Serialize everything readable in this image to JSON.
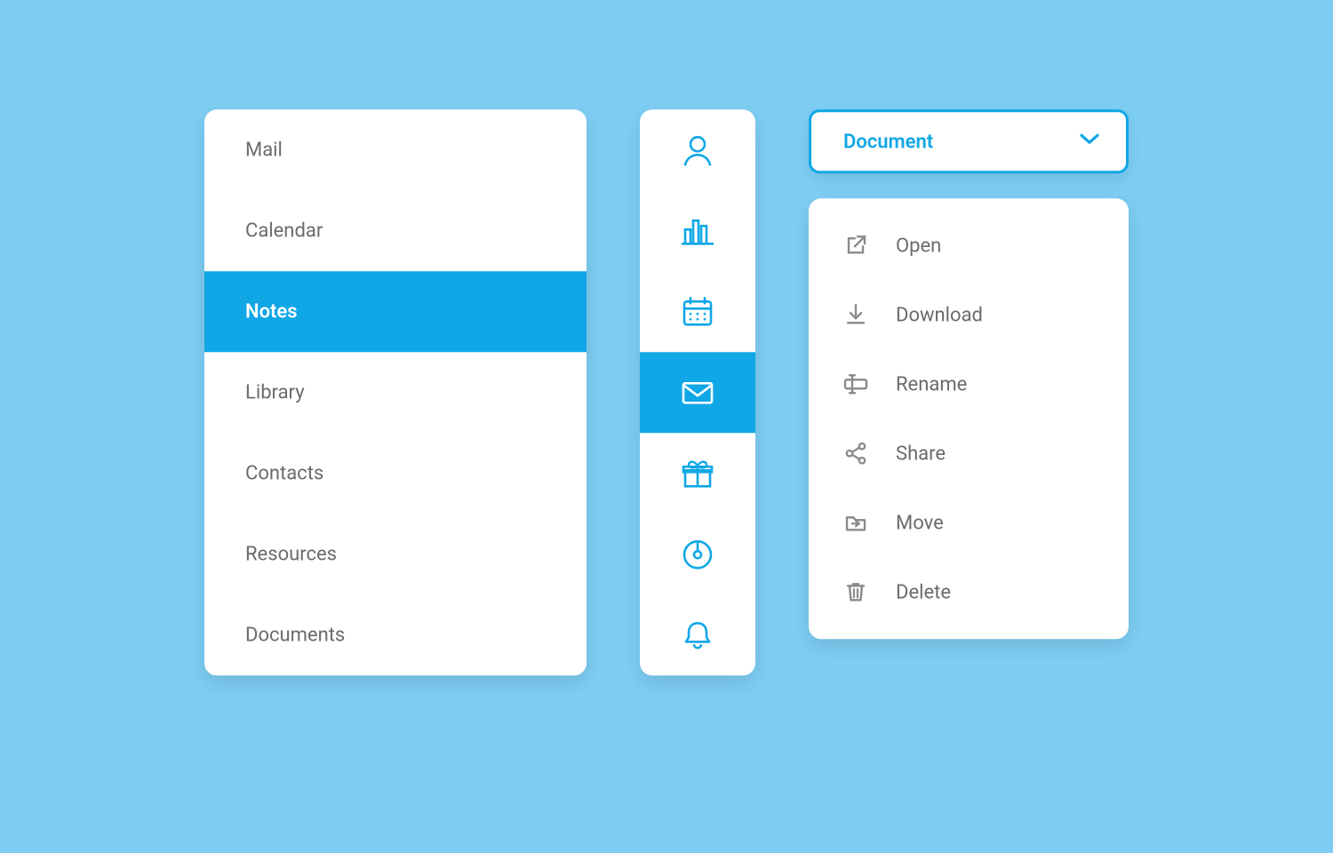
{
  "colors": {
    "accent": "#0fa7e6",
    "bg": "#7ecef4",
    "text": "#6b6b6b"
  },
  "menu": {
    "items": [
      {
        "label": "Mail"
      },
      {
        "label": "Calendar"
      },
      {
        "label": "Notes",
        "active": true
      },
      {
        "label": "Library"
      },
      {
        "label": "Contacts"
      },
      {
        "label": "Resources"
      },
      {
        "label": "Documents"
      }
    ]
  },
  "rail": {
    "items": [
      {
        "icon": "user-icon"
      },
      {
        "icon": "bar-chart-icon"
      },
      {
        "icon": "calendar-icon"
      },
      {
        "icon": "mail-icon",
        "active": true
      },
      {
        "icon": "gift-icon"
      },
      {
        "icon": "disc-icon"
      },
      {
        "icon": "bell-icon"
      }
    ]
  },
  "dropdown": {
    "selected": "Document"
  },
  "actions": {
    "items": [
      {
        "icon": "open-icon",
        "label": "Open"
      },
      {
        "icon": "download-icon",
        "label": "Download"
      },
      {
        "icon": "rename-icon",
        "label": "Rename"
      },
      {
        "icon": "share-icon",
        "label": "Share"
      },
      {
        "icon": "move-icon",
        "label": "Move"
      },
      {
        "icon": "delete-icon",
        "label": "Delete"
      }
    ]
  }
}
